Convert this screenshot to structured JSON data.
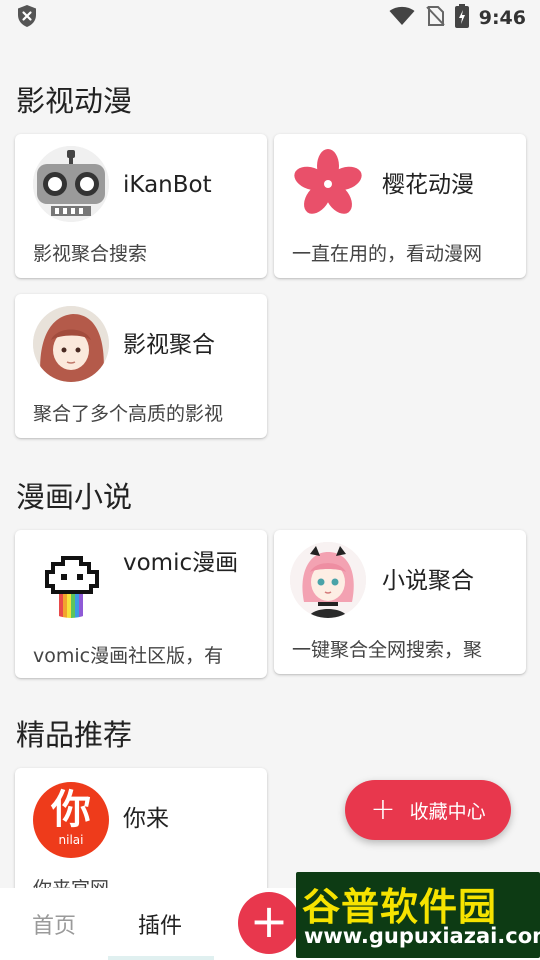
{
  "status_bar": {
    "time": "9:46",
    "icons": [
      "shield-x-icon",
      "wifi-icon",
      "no-sim-icon",
      "battery-charging-icon"
    ]
  },
  "sections": [
    {
      "title": "影视动漫",
      "cards": [
        {
          "name": "iKanBot",
          "desc": "影视聚合搜索",
          "icon": "robot-avatar"
        },
        {
          "name": "樱花动漫",
          "desc": "一直在用的，看动漫网",
          "icon": "sakura-flower-avatar"
        },
        {
          "name": "影视聚合",
          "desc": "聚合了多个高质的影视",
          "icon": "anime-girl-avatar"
        }
      ]
    },
    {
      "title": "漫画小说",
      "cards": [
        {
          "name": "vomic漫画",
          "desc": "vomic漫画社区版，有",
          "icon": "pixel-cloud-rainbow-avatar"
        },
        {
          "name": "小说聚合",
          "desc": "一键聚合全网搜索，聚",
          "icon": "pink-hair-girl-avatar"
        }
      ]
    },
    {
      "title": "精品推荐",
      "cards": [
        {
          "name": "你来",
          "desc": "你来官网",
          "icon": "nilai-logo",
          "logo_text": "你",
          "logo_sub": "nilai"
        }
      ]
    }
  ],
  "fab": {
    "label": "收藏中心",
    "icon": "plus-icon"
  },
  "bottom_nav": {
    "items": [
      "首页",
      "插件"
    ],
    "active": "插件",
    "add_icon": "plus-icon"
  },
  "watermark": {
    "title": "谷普软件园",
    "url": "www.gupuxiazai.com"
  },
  "colors": {
    "accent": "#e8374d",
    "background": "#f5f5f5",
    "card": "#ffffff"
  }
}
